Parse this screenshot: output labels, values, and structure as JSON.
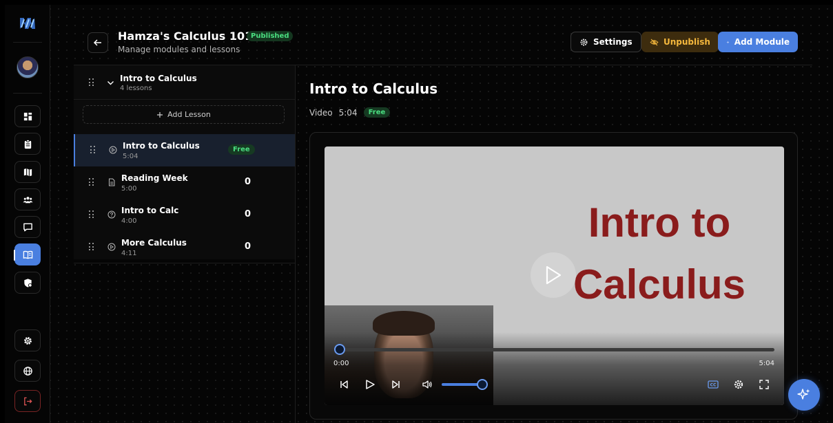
{
  "header": {
    "course_title": "Hamza's Calculus 101",
    "status_badge": "Published",
    "subtitle": "Manage modules and lessons",
    "settings_label": "Settings",
    "unpublish_label": "Unpublish",
    "add_module_label": "Add Module"
  },
  "sidebar": {
    "items": [
      {
        "icon": "dashboard-icon"
      },
      {
        "icon": "clipboard-icon"
      },
      {
        "icon": "map-icon"
      },
      {
        "icon": "users-icon"
      },
      {
        "icon": "chat-icon"
      },
      {
        "icon": "book-icon",
        "active": true
      },
      {
        "icon": "shield-icon"
      },
      {
        "icon": "gear-icon"
      },
      {
        "icon": "globe-icon"
      },
      {
        "icon": "logout-icon"
      }
    ]
  },
  "module": {
    "title": "Intro to Calculus",
    "lesson_count": "4 lessons",
    "add_lesson_label": "Add Lesson",
    "lessons": [
      {
        "title": "Intro to Calculus",
        "duration": "5:04",
        "type": "video",
        "tag": "Free",
        "active": true
      },
      {
        "title": "Reading Week",
        "duration": "5:00",
        "type": "document",
        "count": "0"
      },
      {
        "title": "Intro to Calc",
        "duration": "4:00",
        "type": "quiz",
        "count": "0"
      },
      {
        "title": "More Calculus",
        "duration": "4:11",
        "type": "video",
        "count": "0"
      }
    ]
  },
  "detail": {
    "title": "Intro to Calculus",
    "type": "Video",
    "duration": "5:04",
    "tag": "Free"
  },
  "player": {
    "slide_line1": "Intro to",
    "slide_line2": "Calculus",
    "current_time": "0:00",
    "total_time": "5:04",
    "progress": 0,
    "volume": 1.0
  },
  "colors": {
    "accent": "#4a7fe0",
    "free_green": "#4ade80",
    "unpublish_amber": "#f5b83d",
    "slide_red": "#8a1c1c"
  }
}
